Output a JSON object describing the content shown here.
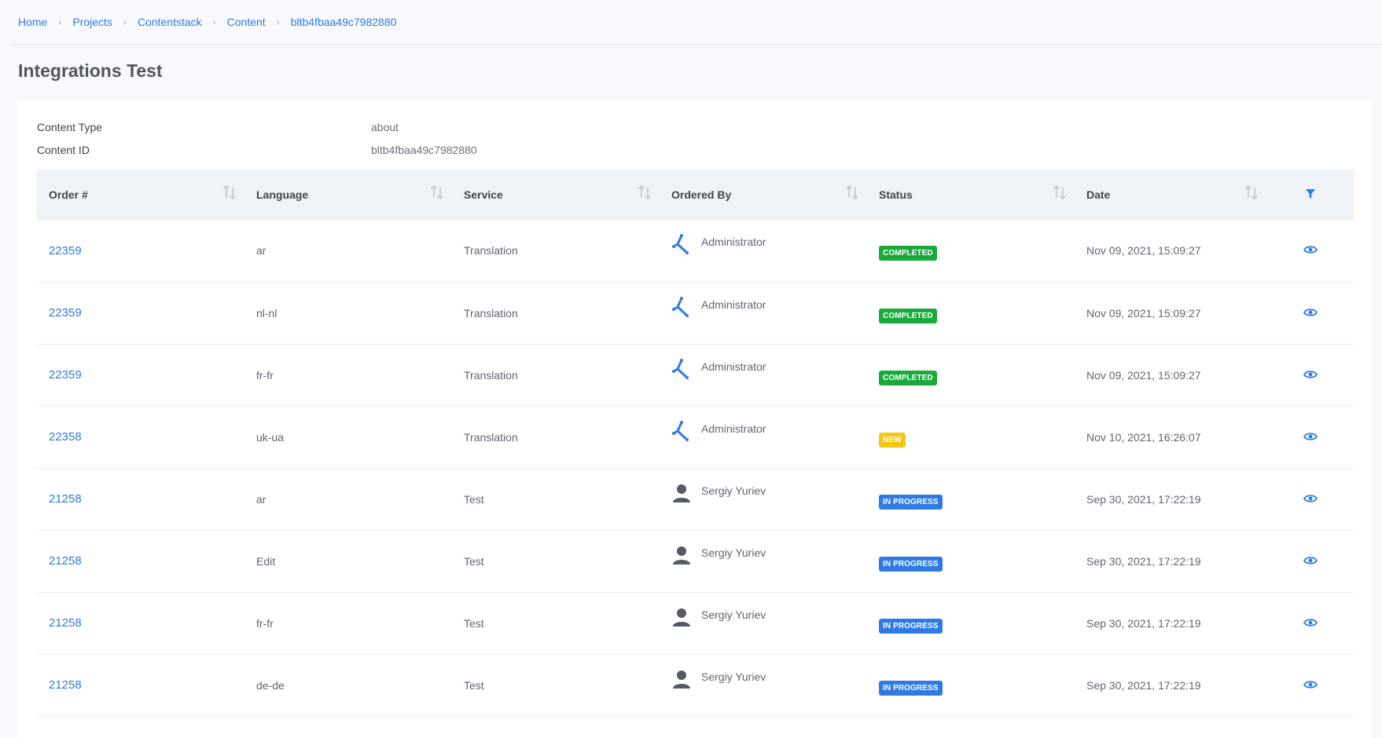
{
  "breadcrumb": [
    "Home",
    "Projects",
    "Contentstack",
    "Content",
    "bltb4fbaa49c7982880"
  ],
  "page_title": "Integrations Test",
  "meta": [
    {
      "label": "Content Type",
      "value": "about"
    },
    {
      "label": "Content ID",
      "value": "bltb4fbaa49c7982880"
    }
  ],
  "columns": [
    "Order #",
    "Language",
    "Service",
    "Ordered By",
    "Status",
    "Date"
  ],
  "status_colors": {
    "COMPLETED": "#1aaa3c",
    "NEW": "#f5c518",
    "IN PROGRESS": "#2f7be2"
  },
  "rows": [
    {
      "order": "22359",
      "language": "ar",
      "service": "Translation",
      "ordered_by": "Administrator",
      "avatar": "contentstack-logo-icon",
      "status": "COMPLETED",
      "date": "Nov 09, 2021, 15:09:27"
    },
    {
      "order": "22359",
      "language": "nl-nl",
      "service": "Translation",
      "ordered_by": "Administrator",
      "avatar": "contentstack-logo-icon",
      "status": "COMPLETED",
      "date": "Nov 09, 2021, 15:09:27"
    },
    {
      "order": "22359",
      "language": "fr-fr",
      "service": "Translation",
      "ordered_by": "Administrator",
      "avatar": "contentstack-logo-icon",
      "status": "COMPLETED",
      "date": "Nov 09, 2021, 15:09:27"
    },
    {
      "order": "22358",
      "language": "uk-ua",
      "service": "Translation",
      "ordered_by": "Administrator",
      "avatar": "contentstack-logo-icon",
      "status": "NEW",
      "date": "Nov 10, 2021, 16:26:07"
    },
    {
      "order": "21258",
      "language": "ar",
      "service": "Test",
      "ordered_by": "Sergiy Yuriev",
      "avatar": "user-icon",
      "status": "IN PROGRESS",
      "date": "Sep 30, 2021, 17:22:19"
    },
    {
      "order": "21258",
      "language": "Edit",
      "service": "Test",
      "ordered_by": "Sergiy Yuriev",
      "avatar": "user-icon",
      "status": "IN PROGRESS",
      "date": "Sep 30, 2021, 17:22:19"
    },
    {
      "order": "21258",
      "language": "fr-fr",
      "service": "Test",
      "ordered_by": "Sergiy Yuriev",
      "avatar": "user-icon",
      "status": "IN PROGRESS",
      "date": "Sep 30, 2021, 17:22:19"
    },
    {
      "order": "21258",
      "language": "de-de",
      "service": "Test",
      "ordered_by": "Sergiy Yuriev",
      "avatar": "user-icon",
      "status": "IN PROGRESS",
      "date": "Sep 30, 2021, 17:22:19"
    }
  ]
}
